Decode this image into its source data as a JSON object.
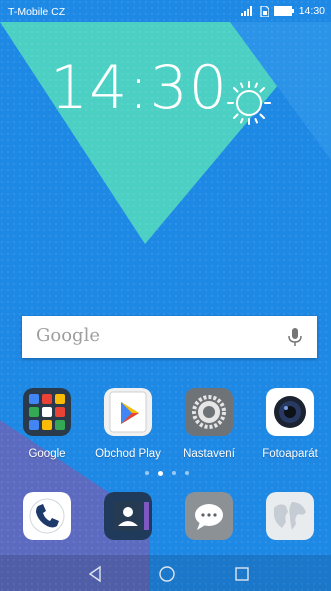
{
  "status_bar": {
    "carrier": "T-Mobile CZ",
    "time": "14:30",
    "icons": [
      "signal-icon",
      "sim-icon",
      "battery-icon"
    ]
  },
  "clock_widget": {
    "time": "14:30",
    "weather_icon": "sun-icon"
  },
  "search_bar": {
    "text": "Google",
    "icon": "mic-icon"
  },
  "apps": [
    {
      "label": "Google",
      "icon": "google-folder-icon"
    },
    {
      "label": "Obchod Play",
      "icon": "play-store-icon"
    },
    {
      "label": "Nastavení",
      "icon": "settings-gear-icon"
    },
    {
      "label": "Fotoaparát",
      "icon": "camera-icon"
    }
  ],
  "page_indicator": {
    "count": 4,
    "active": 1
  },
  "dock": [
    {
      "icon": "phone-icon"
    },
    {
      "icon": "contacts-icon"
    },
    {
      "icon": "messages-icon"
    },
    {
      "icon": "browser-icon"
    }
  ],
  "nav_bar": [
    "back-icon",
    "home-icon",
    "recents-icon"
  ],
  "colors": {
    "wallpaper_blue": "#1e88e5",
    "wallpaper_teal": "#4dd0c4",
    "wallpaper_purple": "#5c6bc0"
  }
}
